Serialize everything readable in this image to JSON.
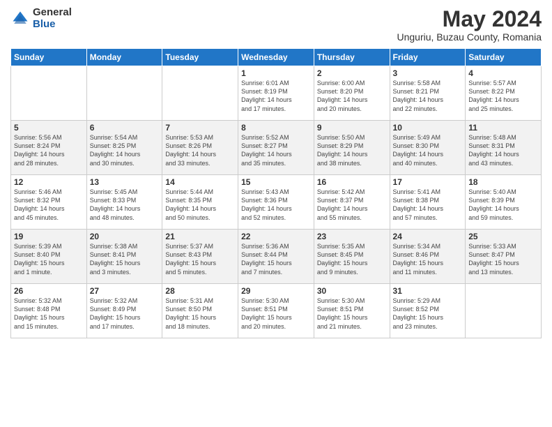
{
  "logo": {
    "general": "General",
    "blue": "Blue"
  },
  "header": {
    "title": "May 2024",
    "subtitle": "Unguriu, Buzau County, Romania"
  },
  "weekdays": [
    "Sunday",
    "Monday",
    "Tuesday",
    "Wednesday",
    "Thursday",
    "Friday",
    "Saturday"
  ],
  "weeks": [
    [
      {
        "day": "",
        "info": ""
      },
      {
        "day": "",
        "info": ""
      },
      {
        "day": "",
        "info": ""
      },
      {
        "day": "1",
        "info": "Sunrise: 6:01 AM\nSunset: 8:19 PM\nDaylight: 14 hours\nand 17 minutes."
      },
      {
        "day": "2",
        "info": "Sunrise: 6:00 AM\nSunset: 8:20 PM\nDaylight: 14 hours\nand 20 minutes."
      },
      {
        "day": "3",
        "info": "Sunrise: 5:58 AM\nSunset: 8:21 PM\nDaylight: 14 hours\nand 22 minutes."
      },
      {
        "day": "4",
        "info": "Sunrise: 5:57 AM\nSunset: 8:22 PM\nDaylight: 14 hours\nand 25 minutes."
      }
    ],
    [
      {
        "day": "5",
        "info": "Sunrise: 5:56 AM\nSunset: 8:24 PM\nDaylight: 14 hours\nand 28 minutes."
      },
      {
        "day": "6",
        "info": "Sunrise: 5:54 AM\nSunset: 8:25 PM\nDaylight: 14 hours\nand 30 minutes."
      },
      {
        "day": "7",
        "info": "Sunrise: 5:53 AM\nSunset: 8:26 PM\nDaylight: 14 hours\nand 33 minutes."
      },
      {
        "day": "8",
        "info": "Sunrise: 5:52 AM\nSunset: 8:27 PM\nDaylight: 14 hours\nand 35 minutes."
      },
      {
        "day": "9",
        "info": "Sunrise: 5:50 AM\nSunset: 8:29 PM\nDaylight: 14 hours\nand 38 minutes."
      },
      {
        "day": "10",
        "info": "Sunrise: 5:49 AM\nSunset: 8:30 PM\nDaylight: 14 hours\nand 40 minutes."
      },
      {
        "day": "11",
        "info": "Sunrise: 5:48 AM\nSunset: 8:31 PM\nDaylight: 14 hours\nand 43 minutes."
      }
    ],
    [
      {
        "day": "12",
        "info": "Sunrise: 5:46 AM\nSunset: 8:32 PM\nDaylight: 14 hours\nand 45 minutes."
      },
      {
        "day": "13",
        "info": "Sunrise: 5:45 AM\nSunset: 8:33 PM\nDaylight: 14 hours\nand 48 minutes."
      },
      {
        "day": "14",
        "info": "Sunrise: 5:44 AM\nSunset: 8:35 PM\nDaylight: 14 hours\nand 50 minutes."
      },
      {
        "day": "15",
        "info": "Sunrise: 5:43 AM\nSunset: 8:36 PM\nDaylight: 14 hours\nand 52 minutes."
      },
      {
        "day": "16",
        "info": "Sunrise: 5:42 AM\nSunset: 8:37 PM\nDaylight: 14 hours\nand 55 minutes."
      },
      {
        "day": "17",
        "info": "Sunrise: 5:41 AM\nSunset: 8:38 PM\nDaylight: 14 hours\nand 57 minutes."
      },
      {
        "day": "18",
        "info": "Sunrise: 5:40 AM\nSunset: 8:39 PM\nDaylight: 14 hours\nand 59 minutes."
      }
    ],
    [
      {
        "day": "19",
        "info": "Sunrise: 5:39 AM\nSunset: 8:40 PM\nDaylight: 15 hours\nand 1 minute."
      },
      {
        "day": "20",
        "info": "Sunrise: 5:38 AM\nSunset: 8:41 PM\nDaylight: 15 hours\nand 3 minutes."
      },
      {
        "day": "21",
        "info": "Sunrise: 5:37 AM\nSunset: 8:43 PM\nDaylight: 15 hours\nand 5 minutes."
      },
      {
        "day": "22",
        "info": "Sunrise: 5:36 AM\nSunset: 8:44 PM\nDaylight: 15 hours\nand 7 minutes."
      },
      {
        "day": "23",
        "info": "Sunrise: 5:35 AM\nSunset: 8:45 PM\nDaylight: 15 hours\nand 9 minutes."
      },
      {
        "day": "24",
        "info": "Sunrise: 5:34 AM\nSunset: 8:46 PM\nDaylight: 15 hours\nand 11 minutes."
      },
      {
        "day": "25",
        "info": "Sunrise: 5:33 AM\nSunset: 8:47 PM\nDaylight: 15 hours\nand 13 minutes."
      }
    ],
    [
      {
        "day": "26",
        "info": "Sunrise: 5:32 AM\nSunset: 8:48 PM\nDaylight: 15 hours\nand 15 minutes."
      },
      {
        "day": "27",
        "info": "Sunrise: 5:32 AM\nSunset: 8:49 PM\nDaylight: 15 hours\nand 17 minutes."
      },
      {
        "day": "28",
        "info": "Sunrise: 5:31 AM\nSunset: 8:50 PM\nDaylight: 15 hours\nand 18 minutes."
      },
      {
        "day": "29",
        "info": "Sunrise: 5:30 AM\nSunset: 8:51 PM\nDaylight: 15 hours\nand 20 minutes."
      },
      {
        "day": "30",
        "info": "Sunrise: 5:30 AM\nSunset: 8:51 PM\nDaylight: 15 hours\nand 21 minutes."
      },
      {
        "day": "31",
        "info": "Sunrise: 5:29 AM\nSunset: 8:52 PM\nDaylight: 15 hours\nand 23 minutes."
      },
      {
        "day": "",
        "info": ""
      }
    ]
  ]
}
